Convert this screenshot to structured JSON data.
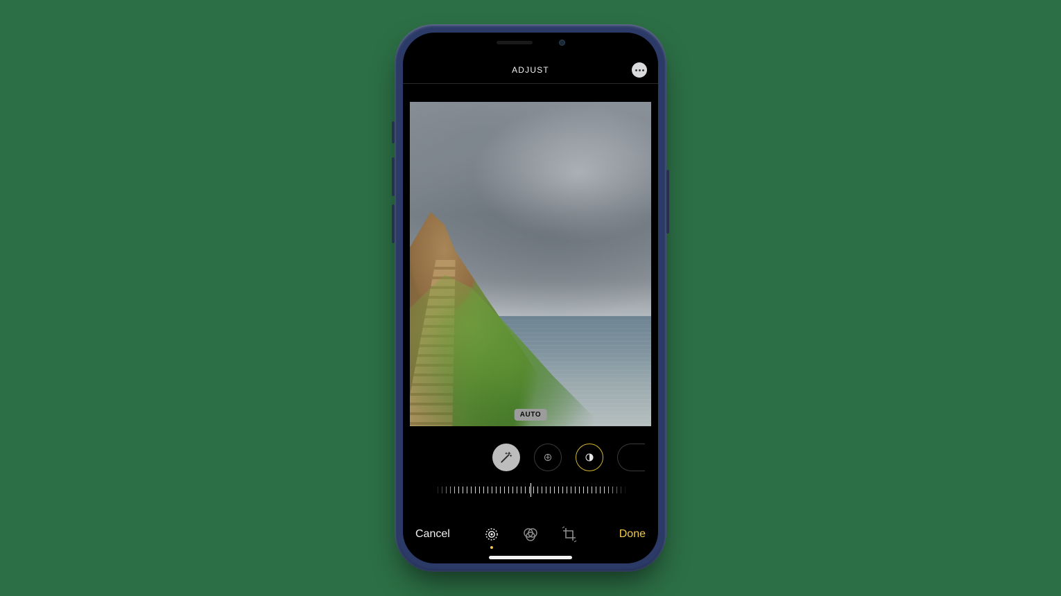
{
  "header": {
    "title": "ADJUST",
    "more_label": "More"
  },
  "photo": {
    "badge": "AUTO"
  },
  "adjustments": {
    "items": [
      {
        "name": "auto",
        "label": "Auto",
        "selected": true
      },
      {
        "name": "exposure",
        "label": "Exposure",
        "selected": false,
        "ring_active": false
      },
      {
        "name": "brilliance",
        "label": "Brilliance",
        "selected": false,
        "ring_active": true
      }
    ],
    "slider_value": 0
  },
  "modes": {
    "items": [
      {
        "name": "adjust",
        "label": "Adjust",
        "active": true
      },
      {
        "name": "filters",
        "label": "Filters",
        "active": false
      },
      {
        "name": "crop",
        "label": "Crop",
        "active": false
      }
    ]
  },
  "footer": {
    "cancel": "Cancel",
    "done": "Done"
  },
  "colors": {
    "accent": "#f2c84b",
    "ring_active": "#d6b82f"
  }
}
